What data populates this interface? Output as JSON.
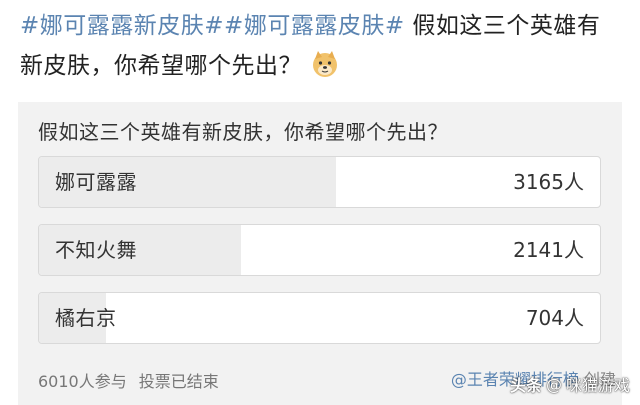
{
  "post": {
    "hashtag1": "#娜可露露新皮肤#",
    "hashtag2": "#娜可露露皮肤#",
    "text_line1": " 假如这三个英雄有",
    "text_line2": "新皮肤，你希望哪个先出？",
    "emoji_icon": "doge-emoji-icon"
  },
  "poll": {
    "question": "假如这三个英雄有新皮肤，你希望哪个先出？",
    "options": [
      {
        "label": "娜可露露",
        "count_text": "3165人",
        "count": 3165,
        "fill_fraction": 0.53
      },
      {
        "label": "不知火舞",
        "count_text": "2141人",
        "count": 2141,
        "fill_fraction": 0.36
      },
      {
        "label": "橘右京",
        "count_text": "704人",
        "count": 704,
        "fill_fraction": 0.12
      }
    ],
    "participants": "6010人参与",
    "status": "投票已结束",
    "creator_name": "@王者荣耀排行榜",
    "creator_suffix": " 创建"
  },
  "watermark": {
    "brand": "头条",
    "separator": "@",
    "account": "咪猫游戏"
  },
  "colors": {
    "hashtag": "#5b84b1",
    "poll_background": "#f2f2f2",
    "option_fill": "#ececec"
  }
}
